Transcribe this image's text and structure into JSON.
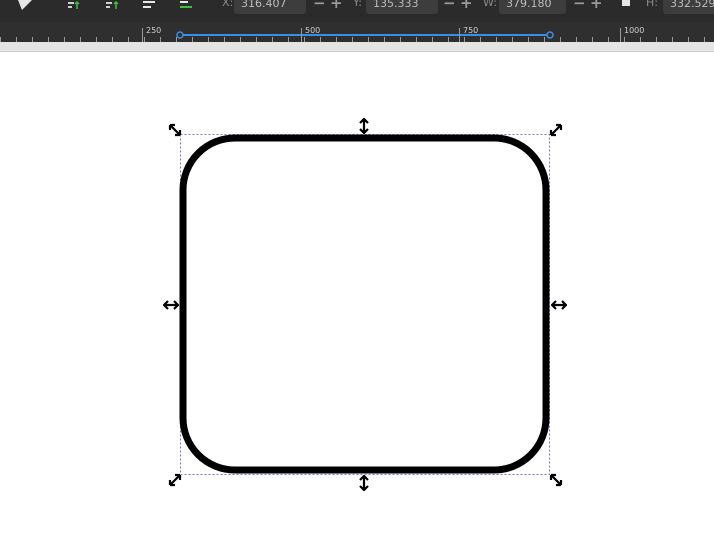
{
  "toolbar": {
    "x_label": "X:",
    "x_value": "316.407",
    "y_label": "Y:",
    "y_value": "135.333",
    "w_label": "W:",
    "w_value": "379.180",
    "h_label": "H:",
    "h_value": "332.529",
    "minus": "−",
    "plus": "+"
  },
  "ruler": {
    "labels": [
      "250",
      "500",
      "750",
      "1000"
    ],
    "accent": "#3a8ee6"
  },
  "canvas": {
    "shape": "rounded-rectangle",
    "stroke": "#000000",
    "background": "#ffffff"
  }
}
